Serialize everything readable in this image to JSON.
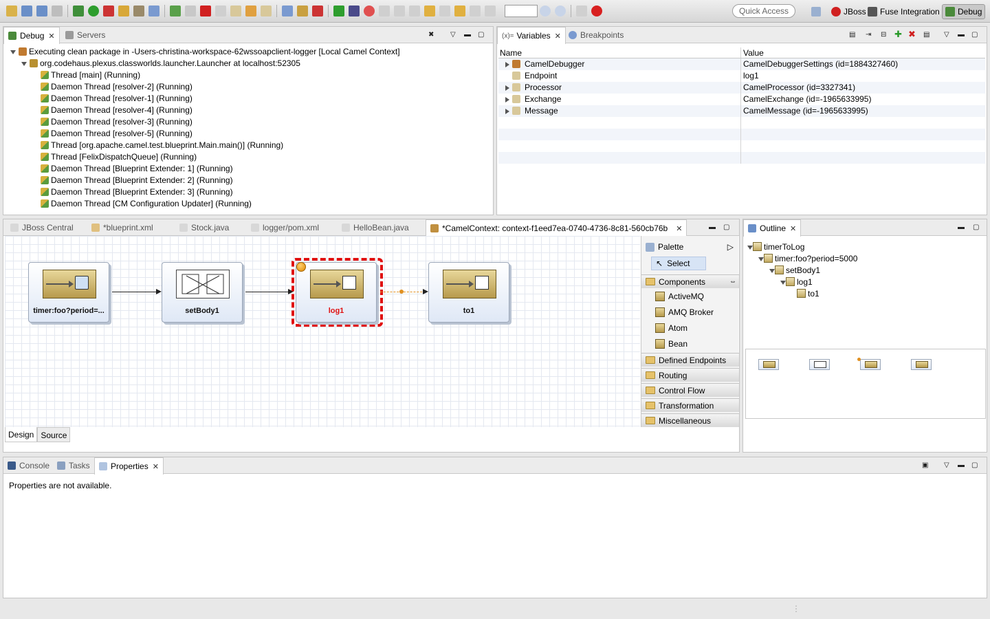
{
  "toolbar": {
    "quick_access": "Quick Access",
    "perspectives": [
      {
        "label": "JBoss",
        "icon": "jboss-icon"
      },
      {
        "label": "Fuse Integration",
        "icon": "fuse-icon"
      },
      {
        "label": "Debug",
        "icon": "debug-icon"
      }
    ]
  },
  "debug_view": {
    "tabs": [
      {
        "label": "Debug"
      },
      {
        "label": "Servers"
      }
    ],
    "launch": "Executing clean package in -Users-christina-workspace-62wssoapclient-logger [Local Camel Context]",
    "target": "org.codehaus.plexus.classworlds.launcher.Launcher at localhost:52305",
    "threads": [
      "Thread [main] (Running)",
      "Daemon Thread [resolver-2] (Running)",
      "Daemon Thread [resolver-1] (Running)",
      "Daemon Thread [resolver-4] (Running)",
      "Daemon Thread [resolver-3] (Running)",
      "Daemon Thread [resolver-5] (Running)",
      "Thread [org.apache.camel.test.blueprint.Main.main()] (Running)",
      "Thread [FelixDispatchQueue] (Running)",
      "Daemon Thread [Blueprint Extender: 1] (Running)",
      "Daemon Thread [Blueprint Extender: 2] (Running)",
      "Daemon Thread [Blueprint Extender: 3] (Running)",
      "Daemon Thread [CM Configuration Updater] (Running)"
    ]
  },
  "variables_view": {
    "tabs": [
      {
        "label": "Variables"
      },
      {
        "label": "Breakpoints"
      }
    ],
    "columns": [
      "Name",
      "Value"
    ],
    "rows": [
      {
        "name": "CamelDebugger",
        "value": "CamelDebuggerSettings (id=1884327460)",
        "expandable": true
      },
      {
        "name": "Endpoint",
        "value": "log1",
        "expandable": false
      },
      {
        "name": "Processor",
        "value": "CamelProcessor (id=3327341)",
        "expandable": true
      },
      {
        "name": "Exchange",
        "value": "CamelExchange (id=-1965633995)",
        "expandable": true
      },
      {
        "name": "Message",
        "value": "CamelMessage (id=-1965633995)",
        "expandable": true
      }
    ]
  },
  "editor": {
    "tabs": [
      {
        "label": "JBoss Central"
      },
      {
        "label": "*blueprint.xml"
      },
      {
        "label": "Stock.java"
      },
      {
        "label": "logger/pom.xml"
      },
      {
        "label": "HelloBean.java"
      },
      {
        "label": "*CamelContext: context-f1eed7ea-0740-4736-8c81-560cb76b"
      }
    ],
    "nodes": [
      {
        "label": "timer:foo?period=...",
        "icon": "clock-icon"
      },
      {
        "label": "setBody1",
        "icon": "transform-icon"
      },
      {
        "label": "log1",
        "icon": "log-icon",
        "breakpoint": true
      },
      {
        "label": "to1",
        "icon": "endpoint-icon"
      }
    ],
    "bottom_tabs": [
      "Design",
      "Source"
    ],
    "palette": {
      "title": "Palette",
      "select": "Select",
      "components_drawer": "Components",
      "components": [
        "ActiveMQ",
        "AMQ Broker",
        "Atom",
        "Bean"
      ],
      "drawers": [
        "Defined Endpoints",
        "Routing",
        "Control Flow",
        "Transformation",
        "Miscellaneous"
      ]
    }
  },
  "outline": {
    "title": "Outline",
    "tree": [
      "timerToLog",
      "timer:foo?period=5000",
      "setBody1",
      "log1",
      "to1"
    ]
  },
  "bottom_panel": {
    "tabs": [
      {
        "label": "Console"
      },
      {
        "label": "Tasks"
      },
      {
        "label": "Properties"
      }
    ],
    "message": "Properties are not available."
  },
  "colors": {
    "breakpoint_border": "#e01010",
    "selected_label": "#e01010",
    "accent": "#3a6cc8"
  }
}
